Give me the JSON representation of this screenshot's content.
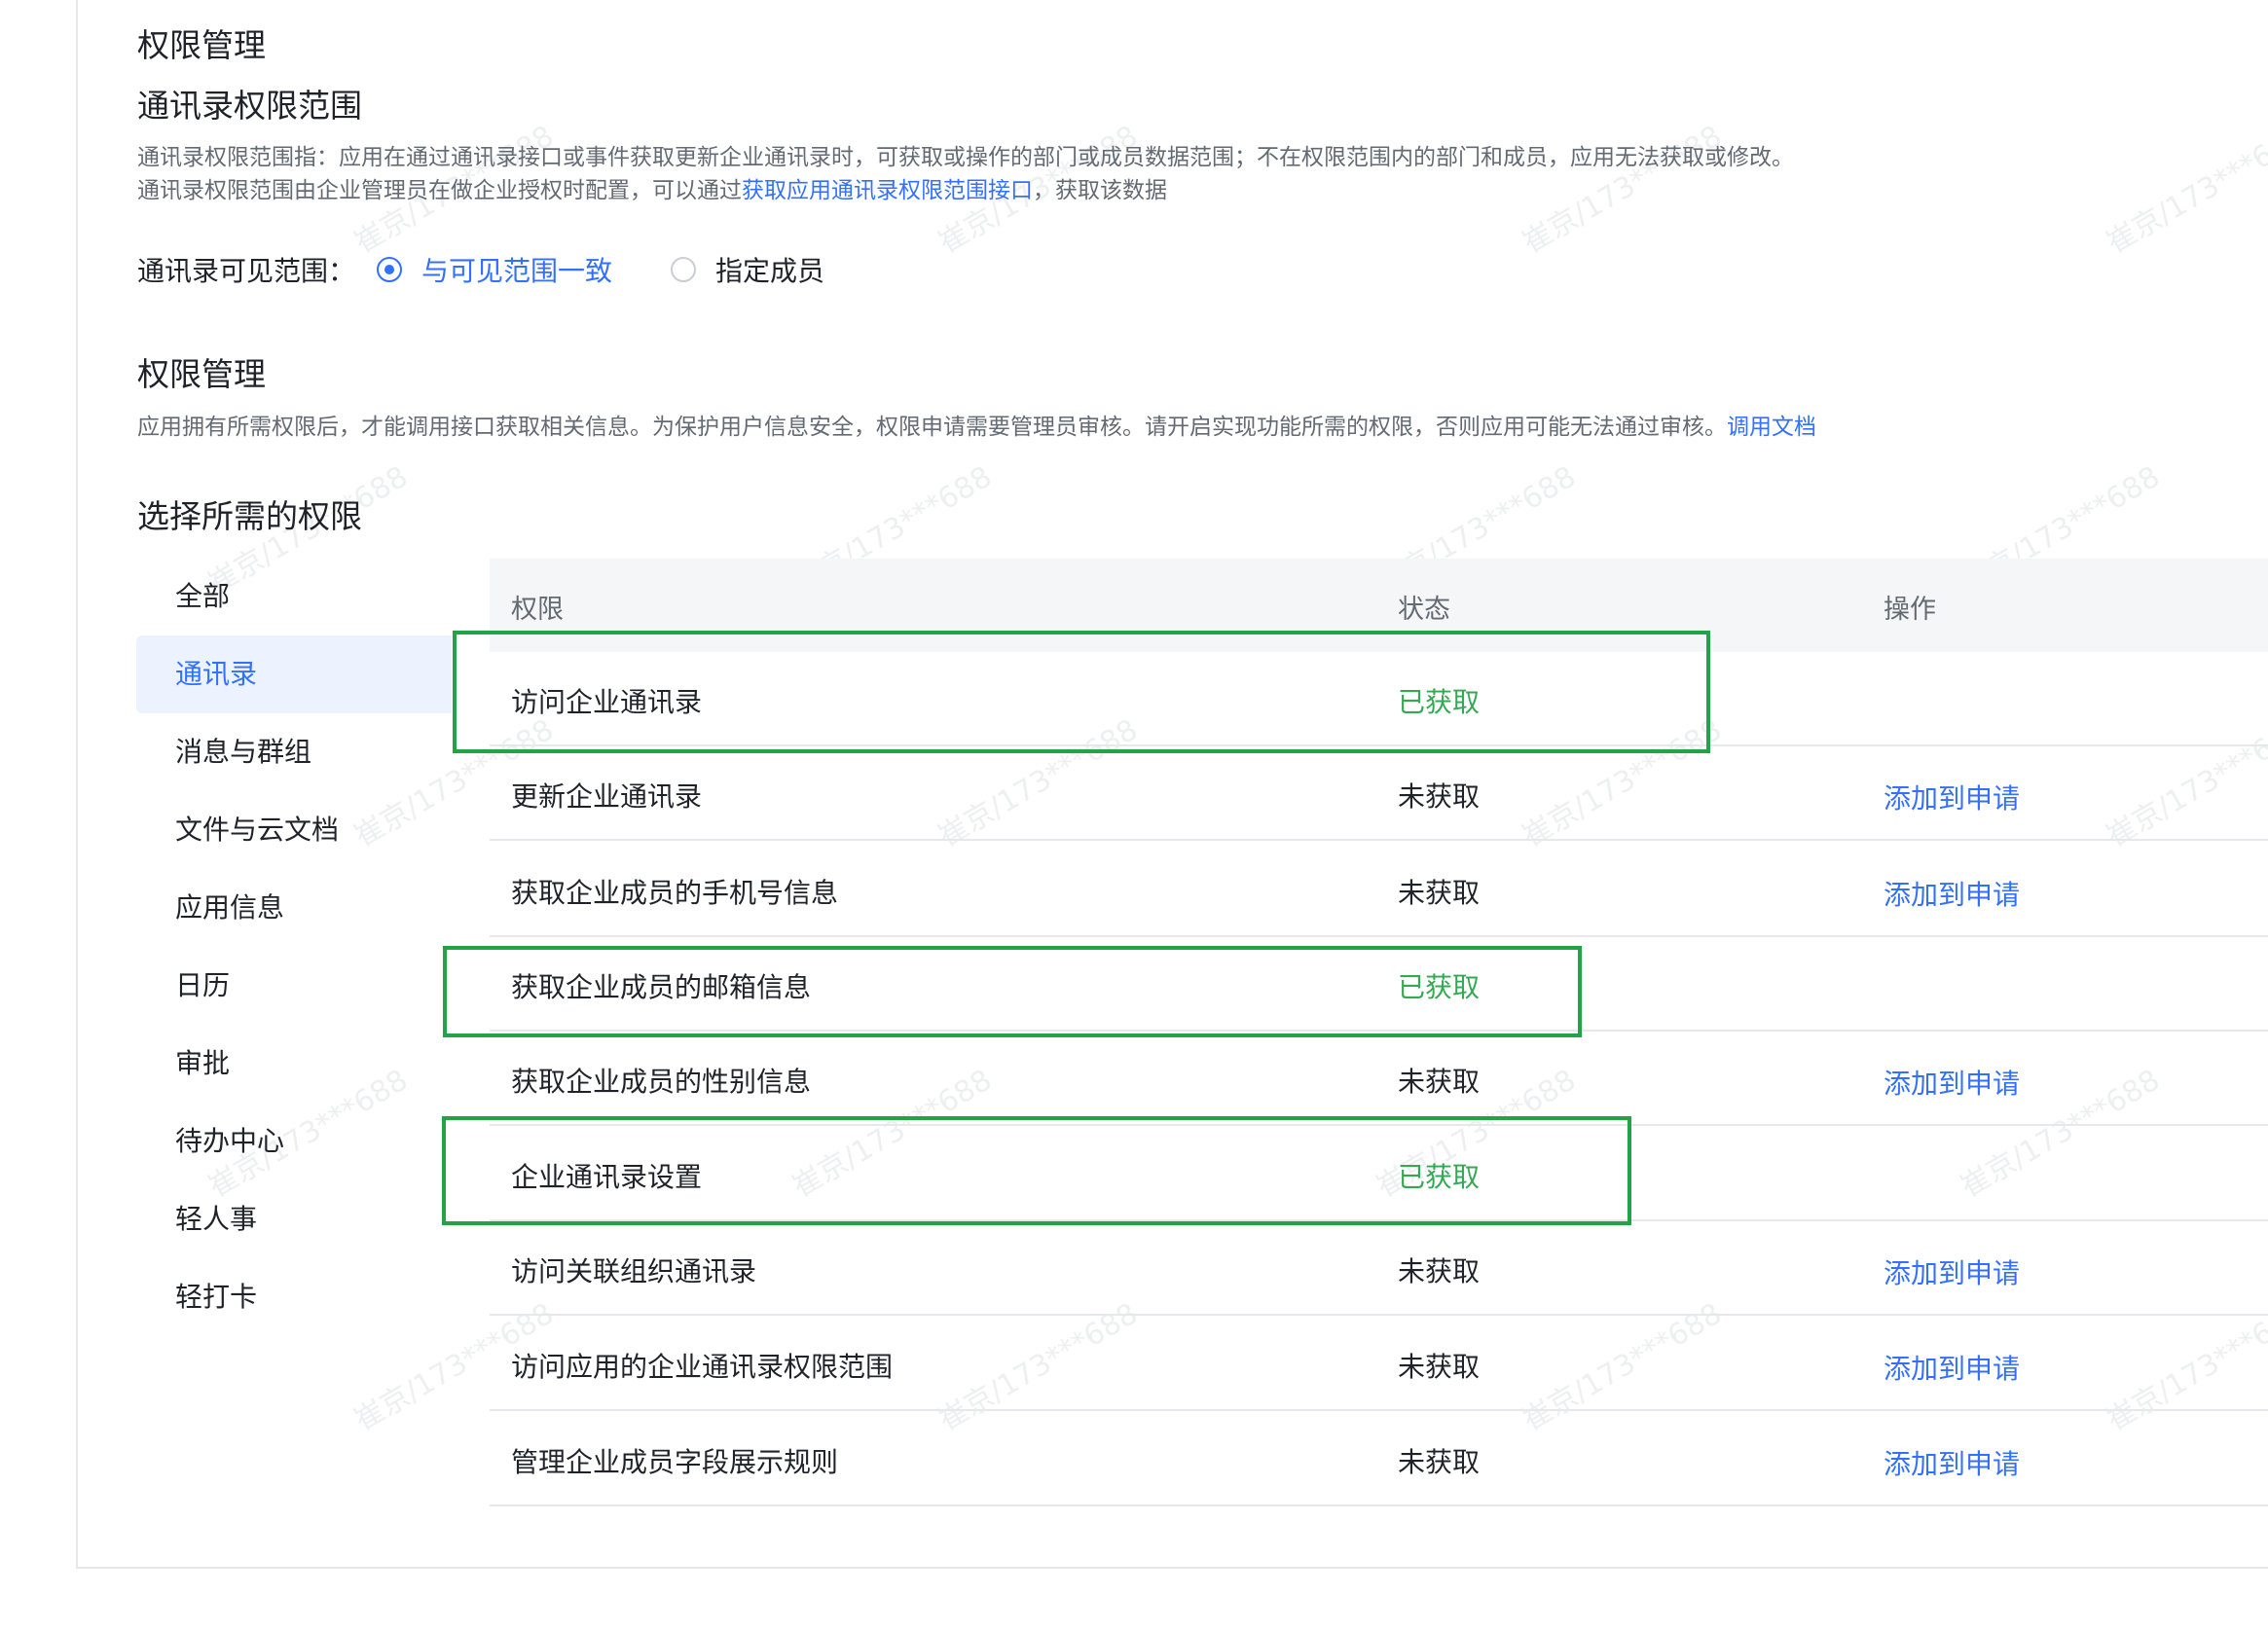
{
  "page": {
    "title": "权限管理"
  },
  "contacts_scope": {
    "title": "通讯录权限范围",
    "desc_line1": "通讯录权限范围指：应用在通过通讯录接口或事件获取更新企业通讯录时，可获取或操作的部门或成员数据范围；不在权限范围内的部门和成员，应用无法获取或修改。",
    "desc_line2_prefix": "通讯录权限范围由企业管理员在做企业授权时配置，可以通过",
    "desc_line2_link": "获取应用通讯录权限范围接口",
    "desc_line2_suffix": "，获取该数据",
    "visible_label": "通讯录可见范围：",
    "options": [
      {
        "label": "与可见范围一致",
        "selected": true
      },
      {
        "label": "指定成员",
        "selected": false
      }
    ]
  },
  "permission_mgmt": {
    "title": "权限管理",
    "desc": "应用拥有所需权限后，才能调用接口获取相关信息。为保护用户信息安全，权限申请需要管理员审核。请开启实现功能所需的权限，否则应用可能无法通过审核。",
    "doc_link": "调用文档"
  },
  "select_section": {
    "title": "选择所需的权限"
  },
  "categories": [
    {
      "label": "全部",
      "active": false
    },
    {
      "label": "通讯录",
      "active": true
    },
    {
      "label": "消息与群组",
      "active": false
    },
    {
      "label": "文件与云文档",
      "active": false
    },
    {
      "label": "应用信息",
      "active": false
    },
    {
      "label": "日历",
      "active": false
    },
    {
      "label": "审批",
      "active": false
    },
    {
      "label": "待办中心",
      "active": false
    },
    {
      "label": "轻人事",
      "active": false
    },
    {
      "label": "轻打卡",
      "active": false
    }
  ],
  "table": {
    "headers": {
      "name": "权限",
      "status": "状态",
      "action": "操作"
    },
    "rows": [
      {
        "name": "访问企业通讯录",
        "status": "已获取",
        "obtained": true,
        "action": "",
        "highlighted": true
      },
      {
        "name": "更新企业通讯录",
        "status": "未获取",
        "obtained": false,
        "action": "添加到申请",
        "highlighted": false
      },
      {
        "name": "获取企业成员的手机号信息",
        "status": "未获取",
        "obtained": false,
        "action": "添加到申请",
        "highlighted": false
      },
      {
        "name": "获取企业成员的邮箱信息",
        "status": "已获取",
        "obtained": true,
        "action": "",
        "highlighted": true
      },
      {
        "name": "获取企业成员的性别信息",
        "status": "未获取",
        "obtained": false,
        "action": "添加到申请",
        "highlighted": false
      },
      {
        "name": "企业通讯录设置",
        "status": "已获取",
        "obtained": true,
        "action": "",
        "highlighted": true
      },
      {
        "name": "访问关联组织通讯录",
        "status": "未获取",
        "obtained": false,
        "action": "添加到申请",
        "highlighted": false
      },
      {
        "name": "访问应用的企业通讯录权限范围",
        "status": "未获取",
        "obtained": false,
        "action": "添加到申请",
        "highlighted": false
      },
      {
        "name": "管理企业成员字段展示规则",
        "status": "未获取",
        "obtained": false,
        "action": "添加到申请",
        "highlighted": false
      }
    ]
  },
  "colors": {
    "accent": "#3370ff",
    "obtained": "#34a853",
    "highlight_box": "#22a346"
  },
  "watermark": {
    "text": "崔京/173***688"
  }
}
